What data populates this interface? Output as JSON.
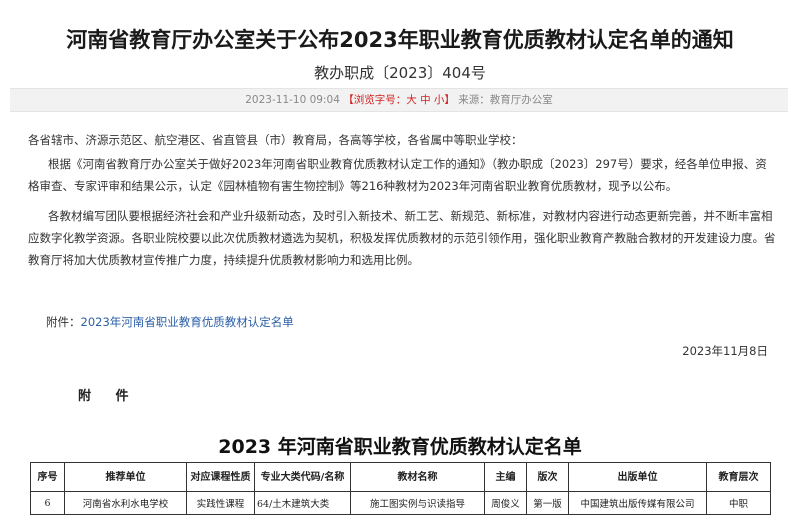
{
  "article": {
    "title": "河南省教育厅办公室关于公布2023年职业教育优质教材认定名单的通知",
    "doc_number": "教办职成〔2023〕404号",
    "meta": {
      "datetime": "2023-11-10 09:04",
      "font_size_prefix": "【浏览字号：",
      "size_large": "大",
      "size_medium": "中",
      "size_small": "小",
      "font_size_suffix": "】",
      "source": "来源：教育厅办公室"
    },
    "salutation": "各省辖市、济源示范区、航空港区、省直管县（市）教育局，各高等学校，各省属中等职业学校：",
    "paragraph1": "根据《河南省教育厅办公室关于做好2023年河南省职业教育优质教材认定工作的通知》（教办职成〔2023〕297号）要求，经各单位申报、资格审查、专家评审和结果公示，认定《园林植物有害生物控制》等216种教材为2023年河南省职业教育优质教材，现予以公布。",
    "paragraph2": "各教材编写团队要根据经济社会和产业升级新动态，及时引入新技术、新工艺、新规范、新标准，对教材内容进行动态更新完善，并不断丰富相应数字化教学资源。各职业院校要以此次优质教材遴选为契机，积极发挥优质教材的示范引领作用，强化职业教育产教融合教材的开发建设力度。省教育厅将加大优质教材宣传推广力度，持续提升优质教材影响力和选用比例。",
    "attachment_prefix": "附件：",
    "attachment_link": "2023年河南省职业教育优质教材认定名单",
    "date": "2023年11月8日"
  },
  "attachment": {
    "heading": "附  件",
    "list_title": "2023 年河南省职业教育优质教材认定名单",
    "columns": [
      "序号",
      "推荐单位",
      "对应课程性质",
      "专业大类代码/名称",
      "教材名称",
      "主编",
      "版次",
      "出版单位",
      "教育层次"
    ],
    "rows": [
      [
        "6",
        "河南省水利水电学校",
        "实践性课程",
        "64/土木建筑大类",
        "施工图实例与识读指导",
        "周俊义",
        "第一版",
        "中国建筑出版传媒有限公司",
        "中职"
      ]
    ]
  }
}
